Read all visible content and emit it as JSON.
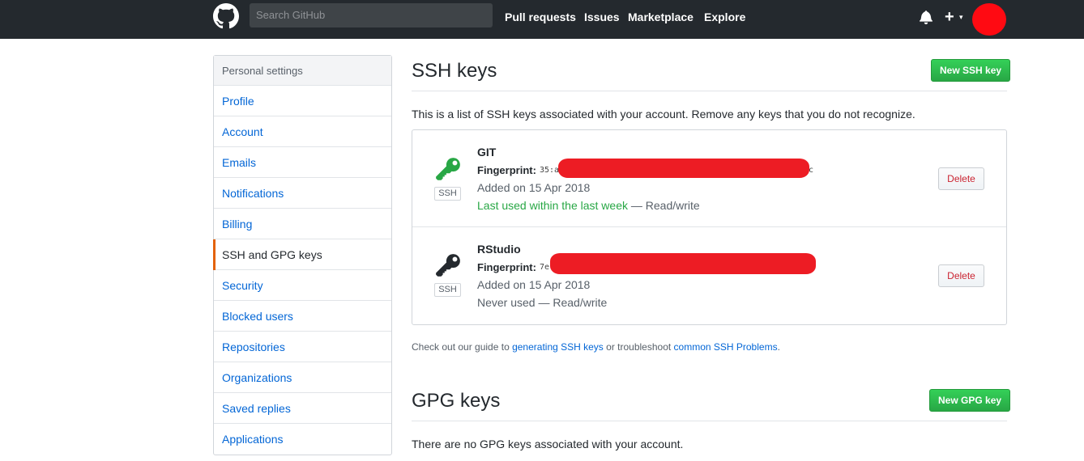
{
  "header": {
    "search_placeholder": "Search GitHub",
    "nav": [
      "Pull requests",
      "Issues",
      "Marketplace",
      "Explore"
    ],
    "icons": {
      "logo": "github-octocat-icon",
      "notifications": "bell-icon",
      "create": "plus-icon",
      "avatar": "avatar"
    },
    "plus_symbol": "+",
    "caret_symbol": "▾"
  },
  "sidebar": {
    "heading": "Personal settings",
    "items": [
      {
        "label": "Profile"
      },
      {
        "label": "Account"
      },
      {
        "label": "Emails"
      },
      {
        "label": "Notifications"
      },
      {
        "label": "Billing"
      },
      {
        "label": "SSH and GPG keys",
        "selected": true
      },
      {
        "label": "Security"
      },
      {
        "label": "Blocked users"
      },
      {
        "label": "Repositories"
      },
      {
        "label": "Organizations"
      },
      {
        "label": "Saved replies"
      },
      {
        "label": "Applications"
      }
    ]
  },
  "ssh": {
    "title": "SSH keys",
    "new_button": "New SSH key",
    "intro": "This is a list of SSH keys associated with your account. Remove any keys that you do not recognize.",
    "keys": [
      {
        "title": "GIT",
        "fingerprint_label": "Fingerprint:",
        "fingerprint_prefix": "35:a",
        "fingerprint_suffix": "c",
        "added": "Added on 15 Apr 2018",
        "usage_recent": "Last used within the last week",
        "usage_rest": " — Read/write",
        "type_label": "SSH",
        "delete_label": "Delete",
        "icon_color": "#28a745"
      },
      {
        "title": "RStudio",
        "fingerprint_label": "Fingerprint:",
        "fingerprint_prefix": "7e",
        "fingerprint_suffix": "",
        "added": "Added on 15 Apr 2018",
        "usage_recent": "",
        "usage_rest": "Never used — Read/write",
        "type_label": "SSH",
        "delete_label": "Delete",
        "icon_color": "#24292e"
      }
    ],
    "guide": {
      "prefix": "Check out our guide to ",
      "link1": "generating SSH keys",
      "middle": " or troubleshoot ",
      "link2": "common SSH Problems",
      "suffix": "."
    }
  },
  "gpg": {
    "title": "GPG keys",
    "new_button": "New GPG key",
    "empty": "There are no GPG keys associated with your account."
  },
  "colors": {
    "header_bg": "#24292e",
    "link": "#0366d6",
    "green": "#28a745",
    "danger": "#cb2431",
    "selected_marker": "#e36209",
    "redaction": "#ed1c24"
  }
}
